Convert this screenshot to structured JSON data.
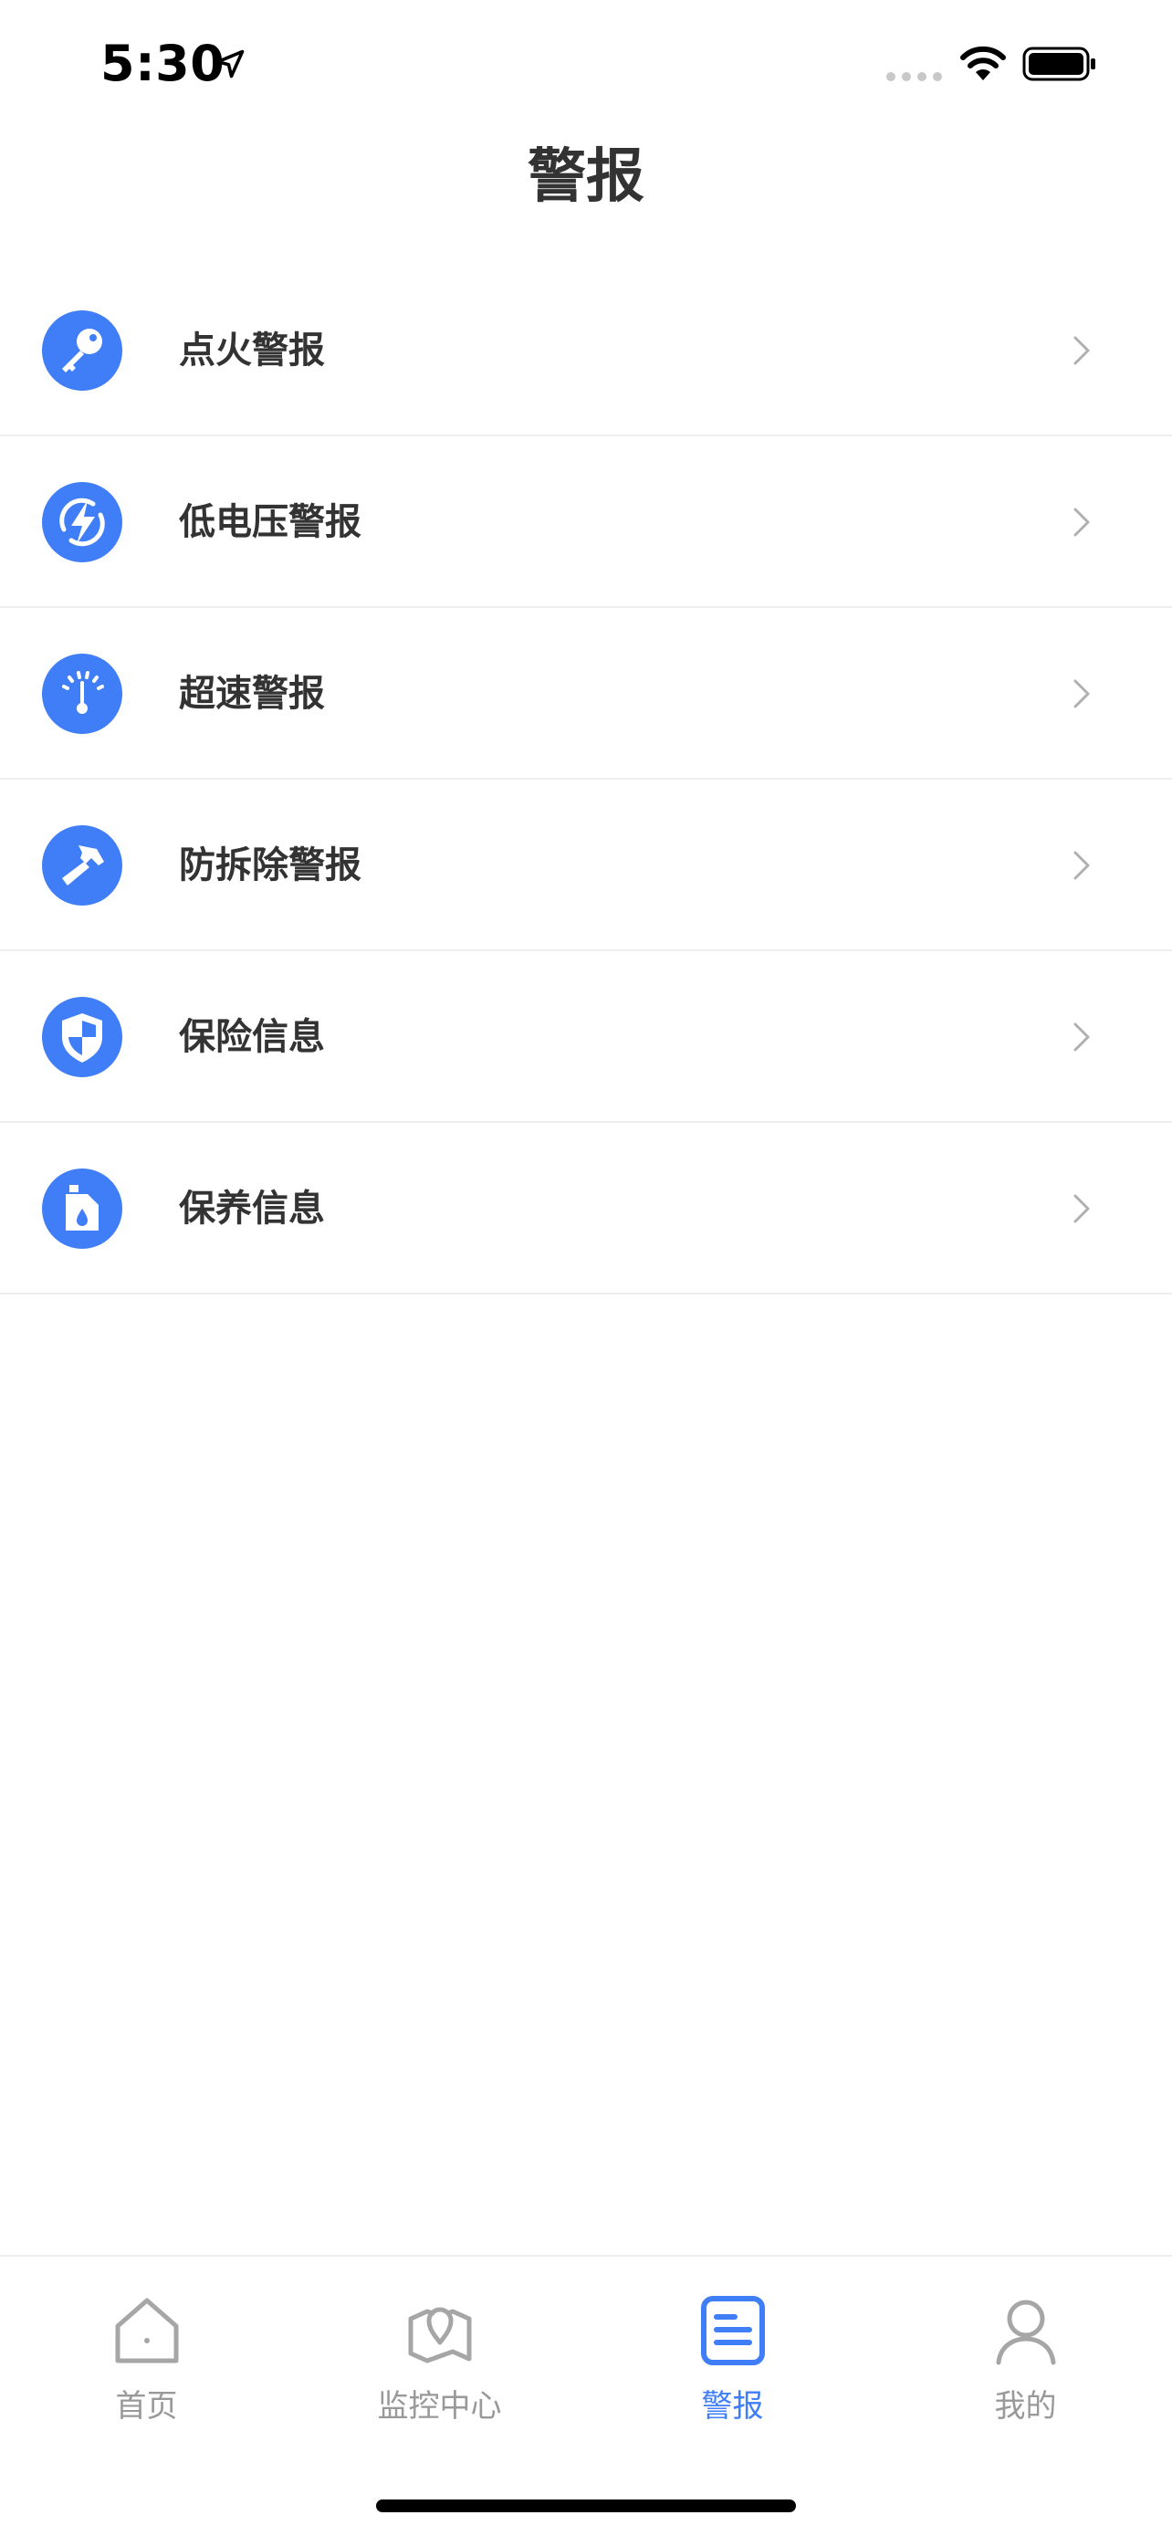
{
  "status_bar": {
    "time": "5:30"
  },
  "nav": {
    "title": "警报"
  },
  "colors": {
    "accent": "#3f7ef7",
    "text": "#333333",
    "inactive": "#999999"
  },
  "menu": {
    "items": [
      {
        "label": "点火警报",
        "icon": "key-icon"
      },
      {
        "label": "低电压警报",
        "icon": "lightning-icon"
      },
      {
        "label": "超速警报",
        "icon": "speedometer-icon"
      },
      {
        "label": "防拆除警报",
        "icon": "hammer-icon"
      },
      {
        "label": "保险信息",
        "icon": "shield-icon"
      },
      {
        "label": "保养信息",
        "icon": "oil-can-icon"
      }
    ]
  },
  "tab_bar": {
    "tabs": [
      {
        "label": "首页",
        "icon": "home-icon",
        "active": false
      },
      {
        "label": "监控中心",
        "icon": "map-pin-icon",
        "active": false
      },
      {
        "label": "警报",
        "icon": "document-icon",
        "active": true
      },
      {
        "label": "我的",
        "icon": "person-icon",
        "active": false
      }
    ]
  }
}
